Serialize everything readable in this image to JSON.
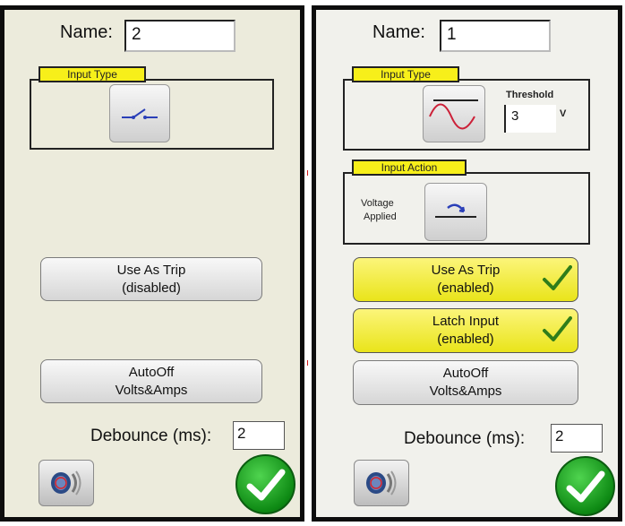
{
  "left_panel": {
    "name_label": "Name:",
    "name_value": "2",
    "input_type_title": "Input Type",
    "input_type_icon": "switch-contact-icon",
    "trip_button": {
      "line1": "Use As Trip",
      "line2": "(disabled)",
      "state": "disabled"
    },
    "autooff_button": {
      "line1": "AutoOff",
      "line2": "Volts&Amps"
    },
    "debounce_label": "Debounce (ms):",
    "debounce_value": "2",
    "sound_icon": "speaker-icon",
    "ok_icon": "checkmark-icon"
  },
  "right_panel": {
    "name_label": "Name:",
    "name_value": "1",
    "input_type_title": "Input Type",
    "input_type_icon": "sine-wave-icon",
    "threshold_label": "Threshold",
    "threshold_value": "3",
    "threshold_unit": "V",
    "input_action_title": "Input Action",
    "input_action_label_1": "Voltage",
    "input_action_label_2": "Applied",
    "input_action_icon": "contact-closing-icon",
    "trip_button": {
      "line1": "Use As Trip",
      "line2": "(enabled)",
      "state": "enabled"
    },
    "latch_button": {
      "line1": "Latch Input",
      "line2": "(enabled)",
      "state": "enabled"
    },
    "autooff_button": {
      "line1": "AutoOff",
      "line2": "Volts&Amps"
    },
    "debounce_label": "Debounce (ms):",
    "debounce_value": "2",
    "sound_icon": "speaker-icon",
    "ok_icon": "checkmark-icon"
  },
  "colors": {
    "accent_yellow": "#f7ef1a",
    "enabled_button": "#eee72a",
    "ok_green": "#0e8a14",
    "check_green": "#2f7d1a"
  }
}
